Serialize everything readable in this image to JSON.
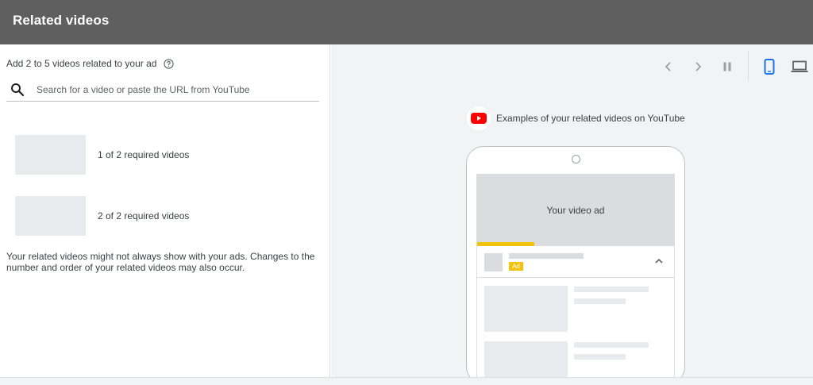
{
  "header": {
    "title": "Related videos"
  },
  "left": {
    "instruction": "Add 2 to 5 videos related to your ad",
    "search": {
      "placeholder": "Search for a video or paste the URL from YouTube",
      "value": ""
    },
    "slots": [
      {
        "label": "1 of 2 required videos"
      },
      {
        "label": "2 of 2 required videos"
      }
    ],
    "note": "Your related videos might not always show with your ads. Changes to the number and order of your related videos may also occur."
  },
  "preview": {
    "toolbar": {
      "icons": [
        "chevron-left-icon",
        "chevron-right-icon",
        "pause-icon",
        "mobile-icon",
        "laptop-icon"
      ],
      "selected_device": "mobile"
    },
    "examples_label": "Examples of your related videos on YouTube",
    "phone": {
      "video_label": "Your video ad",
      "ad_badge": "Ad",
      "progress": 0.29
    },
    "colors": {
      "header_bg": "#5f5f5f",
      "panel_bg": "#f1f3f4",
      "active_icon": "#1a73e8",
      "youtube_red": "#ff0000",
      "ad_yellow": "#f4c20d"
    }
  }
}
